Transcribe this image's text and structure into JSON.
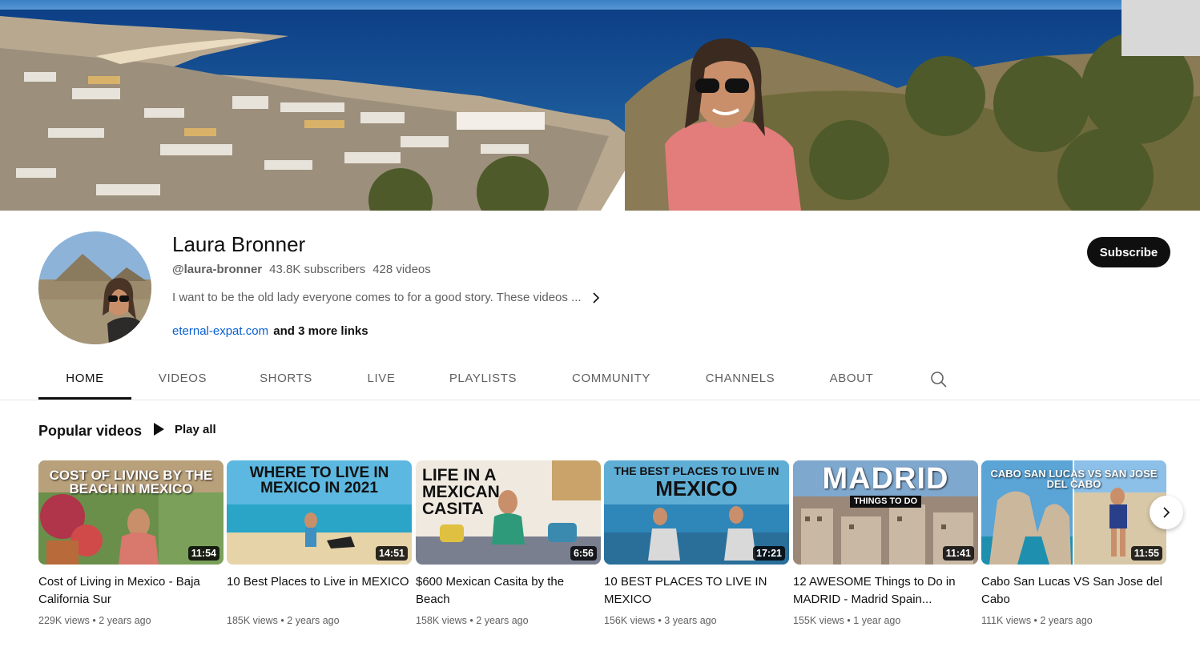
{
  "channel": {
    "name": "Laura Bronner",
    "handle": "@laura-bronner",
    "subscribers": "43.8K subscribers",
    "video_count": "428 videos",
    "description": "I want to be the old lady everyone comes to for a good story. These videos ...",
    "link": "eternal-expat.com",
    "more_links": "and 3 more links",
    "subscribe_label": "Subscribe"
  },
  "tabs": [
    {
      "label": "HOME",
      "active": true
    },
    {
      "label": "VIDEOS",
      "active": false
    },
    {
      "label": "SHORTS",
      "active": false
    },
    {
      "label": "LIVE",
      "active": false
    },
    {
      "label": "PLAYLISTS",
      "active": false
    },
    {
      "label": "COMMUNITY",
      "active": false
    },
    {
      "label": "CHANNELS",
      "active": false
    },
    {
      "label": "ABOUT",
      "active": false
    }
  ],
  "section": {
    "title": "Popular videos",
    "play_all": "Play all"
  },
  "videos": [
    {
      "title": "Cost of Living in Mexico - Baja California Sur",
      "views": "229K views",
      "age": "2 years ago",
      "duration": "11:54",
      "thumb_text": [
        "COST OF LIVING BY THE",
        "BEACH IN MEXICO"
      ]
    },
    {
      "title": "10 Best Places to Live in MEXICO",
      "views": "185K views",
      "age": "2 years ago",
      "duration": "14:51",
      "thumb_text": [
        "WHERE TO LIVE IN",
        "MEXICO IN 2021"
      ]
    },
    {
      "title": "$600 Mexican Casita by the Beach",
      "views": "158K views",
      "age": "2 years ago",
      "duration": "6:56",
      "thumb_text": [
        "LIFE IN A",
        "MEXICAN",
        "CASITA"
      ]
    },
    {
      "title": "10 BEST PLACES TO LIVE IN MEXICO",
      "views": "156K views",
      "age": "3 years ago",
      "duration": "17:21",
      "thumb_text": [
        "THE BEST PLACES TO LIVE IN",
        "MEXICO"
      ]
    },
    {
      "title": "12 AWESOME Things to Do in MADRID - Madrid Spain...",
      "views": "155K views",
      "age": "1 year ago",
      "duration": "11:41",
      "thumb_text": [
        "MADRID",
        "THINGS TO DO"
      ]
    },
    {
      "title": "Cabo San Lucas VS San Jose del Cabo",
      "views": "111K views",
      "age": "2 years ago",
      "duration": "11:55",
      "thumb_text": [
        "CABO SAN LUCAS VS SAN JOSE DEL CABO"
      ]
    }
  ],
  "icons": {
    "search": "search-icon",
    "next": "chevron-right-icon",
    "play": "play-icon",
    "description_more": "chevron-right-icon"
  },
  "colors": {
    "subscribe_bg": "#0f0f0f",
    "link": "#065fd4",
    "secondary_text": "#606060"
  }
}
